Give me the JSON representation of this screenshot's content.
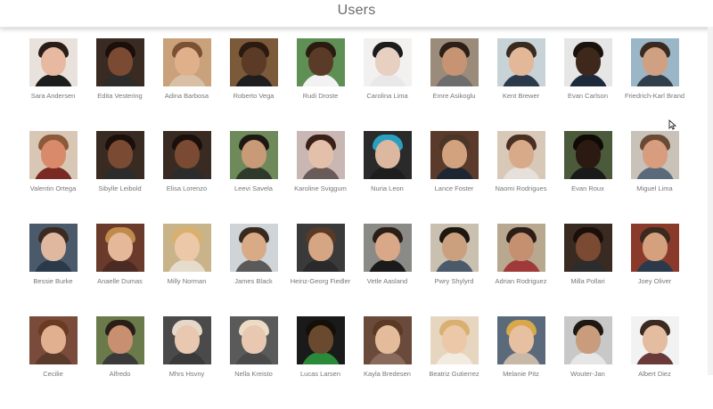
{
  "header": {
    "title": "Users"
  },
  "users": [
    {
      "name": "Sara Andersen",
      "bg": "#e9e2dc",
      "skin": "#e7b9a1",
      "hair": "#2a1d18",
      "shirt": "#1d1d1d"
    },
    {
      "name": "Edita Vestering",
      "bg": "#3a2b22",
      "skin": "#7a4b32",
      "hair": "#1a0f0a",
      "shirt": "#2c2c2c"
    },
    {
      "name": "Adina Barbosa",
      "bg": "#c9a27c",
      "skin": "#e0b08b",
      "hair": "#7a5233",
      "shirt": "#d8c0a6"
    },
    {
      "name": "Roberto Vega",
      "bg": "#7b5a3a",
      "skin": "#5b3a26",
      "hair": "#2a1a10",
      "shirt": "#1e1e1e"
    },
    {
      "name": "Rudi Droste",
      "bg": "#5f8f54",
      "skin": "#5a3b28",
      "hair": "#2a1a10",
      "shirt": "#f2f2f2"
    },
    {
      "name": "Carolina Lima",
      "bg": "#f3f1f0",
      "skin": "#e7cfc1",
      "hair": "#1c1c1c",
      "shirt": "#e8e8e8"
    },
    {
      "name": "Emre Asikoglu",
      "bg": "#9a8b7a",
      "skin": "#c69373",
      "hair": "#2b1f18",
      "shirt": "#6d6d6d"
    },
    {
      "name": "Kent Brewer",
      "bg": "#c8d3d8",
      "skin": "#e2b898",
      "hair": "#3a2b20",
      "shirt": "#2b3a4a"
    },
    {
      "name": "Evan Carlson",
      "bg": "#e6e6e6",
      "skin": "#3e281c",
      "hair": "#1b120c",
      "shirt": "#1c2a3c"
    },
    {
      "name": "Friedrich-Karl Brand",
      "bg": "#9bb6c6",
      "skin": "#cfa182",
      "hair": "#3a2a20",
      "shirt": "#2f3e4a"
    },
    {
      "name": "Valentin Ortega",
      "bg": "#d9c7b5",
      "skin": "#d98a6a",
      "hair": "#8a5a3a",
      "shirt": "#7a2a22"
    },
    {
      "name": "Sibylle Leibold",
      "bg": "#3a2b22",
      "skin": "#7a4b32",
      "hair": "#1a0f0a",
      "shirt": "#2c2c2c"
    },
    {
      "name": "Elisa Lorenzo",
      "bg": "#3a2b22",
      "skin": "#7a4b32",
      "hair": "#1a0f0a",
      "shirt": "#2c2c2c"
    },
    {
      "name": "Leevi Savela",
      "bg": "#6f8a5a",
      "skin": "#c89a78",
      "hair": "#1e1812",
      "shirt": "#2e3b2a"
    },
    {
      "name": "Karoline Sviggum",
      "bg": "#c9b7b4",
      "skin": "#e4c0aa",
      "hair": "#3a2018",
      "shirt": "#6b5a5a"
    },
    {
      "name": "Nuria Leon",
      "bg": "#2a2a2a",
      "skin": "#dcb8a0",
      "hair": "#2aa0c0",
      "shirt": "#1e1e1e"
    },
    {
      "name": "Lance Foster",
      "bg": "#5a3a2a",
      "skin": "#d2a27e",
      "hair": "#4a3526",
      "shirt": "#1e2634"
    },
    {
      "name": "Naomi Rodrigues",
      "bg": "#d8c8b8",
      "skin": "#d9aa8a",
      "hair": "#4a2e20",
      "shirt": "#e6e0da"
    },
    {
      "name": "Evan Roux",
      "bg": "#4a5a3a",
      "skin": "#2a1a12",
      "hair": "#100a06",
      "shirt": "#1a1a1a"
    },
    {
      "name": "Miguel Lima",
      "bg": "#c9c2b8",
      "skin": "#d89c7e",
      "hair": "#6a4a34",
      "shirt": "#5a6a7a"
    },
    {
      "name": "Bessie Burke",
      "bg": "#4a5a6a",
      "skin": "#e0b8a0",
      "hair": "#3a2a22",
      "shirt": "#2a3a4a"
    },
    {
      "name": "Anaelle Dumas",
      "bg": "#6a3a2a",
      "skin": "#e4b898",
      "hair": "#c08a4a",
      "shirt": "#4a2a22"
    },
    {
      "name": "Milly Norman",
      "bg": "#c9b48a",
      "skin": "#ecc8a8",
      "hair": "#d9b070",
      "shirt": "#e6dccc"
    },
    {
      "name": "James Black",
      "bg": "#cfd4d8",
      "skin": "#d9aa86",
      "hair": "#3a2a1e",
      "shirt": "#5a5a5a"
    },
    {
      "name": "Heinz-Georg Fiedler",
      "bg": "#3a3a3a",
      "skin": "#d6a684",
      "hair": "#5a3a24",
      "shirt": "#2a2a2a"
    },
    {
      "name": "Vetle Aasland",
      "bg": "#8a8a86",
      "skin": "#d8a888",
      "hair": "#2a1e16",
      "shirt": "#1a1a1a"
    },
    {
      "name": "Pwry Shylyrd",
      "bg": "#c9c0b0",
      "skin": "#caa07e",
      "hair": "#1e1610",
      "shirt": "#4a5a6a"
    },
    {
      "name": "Adrian Rodriguez",
      "bg": "#b8a890",
      "skin": "#c49070",
      "hair": "#2a1e16",
      "shirt": "#a03a3a"
    },
    {
      "name": "Milla Pollari",
      "bg": "#3a2b22",
      "skin": "#7a4b32",
      "hair": "#1a0f0a",
      "shirt": "#2c2c2c"
    },
    {
      "name": "Joey Oliver",
      "bg": "#8a3a2a",
      "skin": "#d4a07e",
      "hair": "#3a2a1e",
      "shirt": "#2a3a4a"
    },
    {
      "name": "Cecilie",
      "bg": "#7a4a3a",
      "skin": "#e0b090",
      "hair": "#6a3a22",
      "shirt": "#5a3a2a"
    },
    {
      "name": "Alfredo",
      "bg": "#6a7a4a",
      "skin": "#c89070",
      "hair": "#2a1e16",
      "shirt": "#3a3a3a"
    },
    {
      "name": "Mhrs Hsvny",
      "bg": "#4a4a4a",
      "skin": "#e8c8b0",
      "hair": "#e6d8c8",
      "shirt": "#3a3a3a"
    },
    {
      "name": "Nella Kreisto",
      "bg": "#5a5a5a",
      "skin": "#e8c8b0",
      "hair": "#ecdcc4",
      "shirt": "#4a4a4a"
    },
    {
      "name": "Lucas Larsen",
      "bg": "#1a1a1a",
      "skin": "#6a4a2e",
      "hair": "#141008",
      "shirt": "#2a8a3a"
    },
    {
      "name": "Kayla Bredesen",
      "bg": "#6a4a3a",
      "skin": "#e4bc9c",
      "hair": "#5a3a24",
      "shirt": "#8a6a5a"
    },
    {
      "name": "Beatriz Gutierrez",
      "bg": "#e6d6c0",
      "skin": "#ecc8a8",
      "hair": "#d8b070",
      "shirt": "#f2ebe0"
    },
    {
      "name": "Melanie Pitz",
      "bg": "#5a6a7a",
      "skin": "#e6c0a0",
      "hair": "#d8a84a",
      "shirt": "#c8b8a8"
    },
    {
      "name": "Wouter-Jan",
      "bg": "#c8c8c8",
      "skin": "#c89c7c",
      "hair": "#1e1812",
      "shirt": "#e6e6e6"
    },
    {
      "name": "Albert Diez",
      "bg": "#f2f2f2",
      "skin": "#e4bca0",
      "hair": "#3a2a20",
      "shirt": "#6a3a3a"
    }
  ]
}
